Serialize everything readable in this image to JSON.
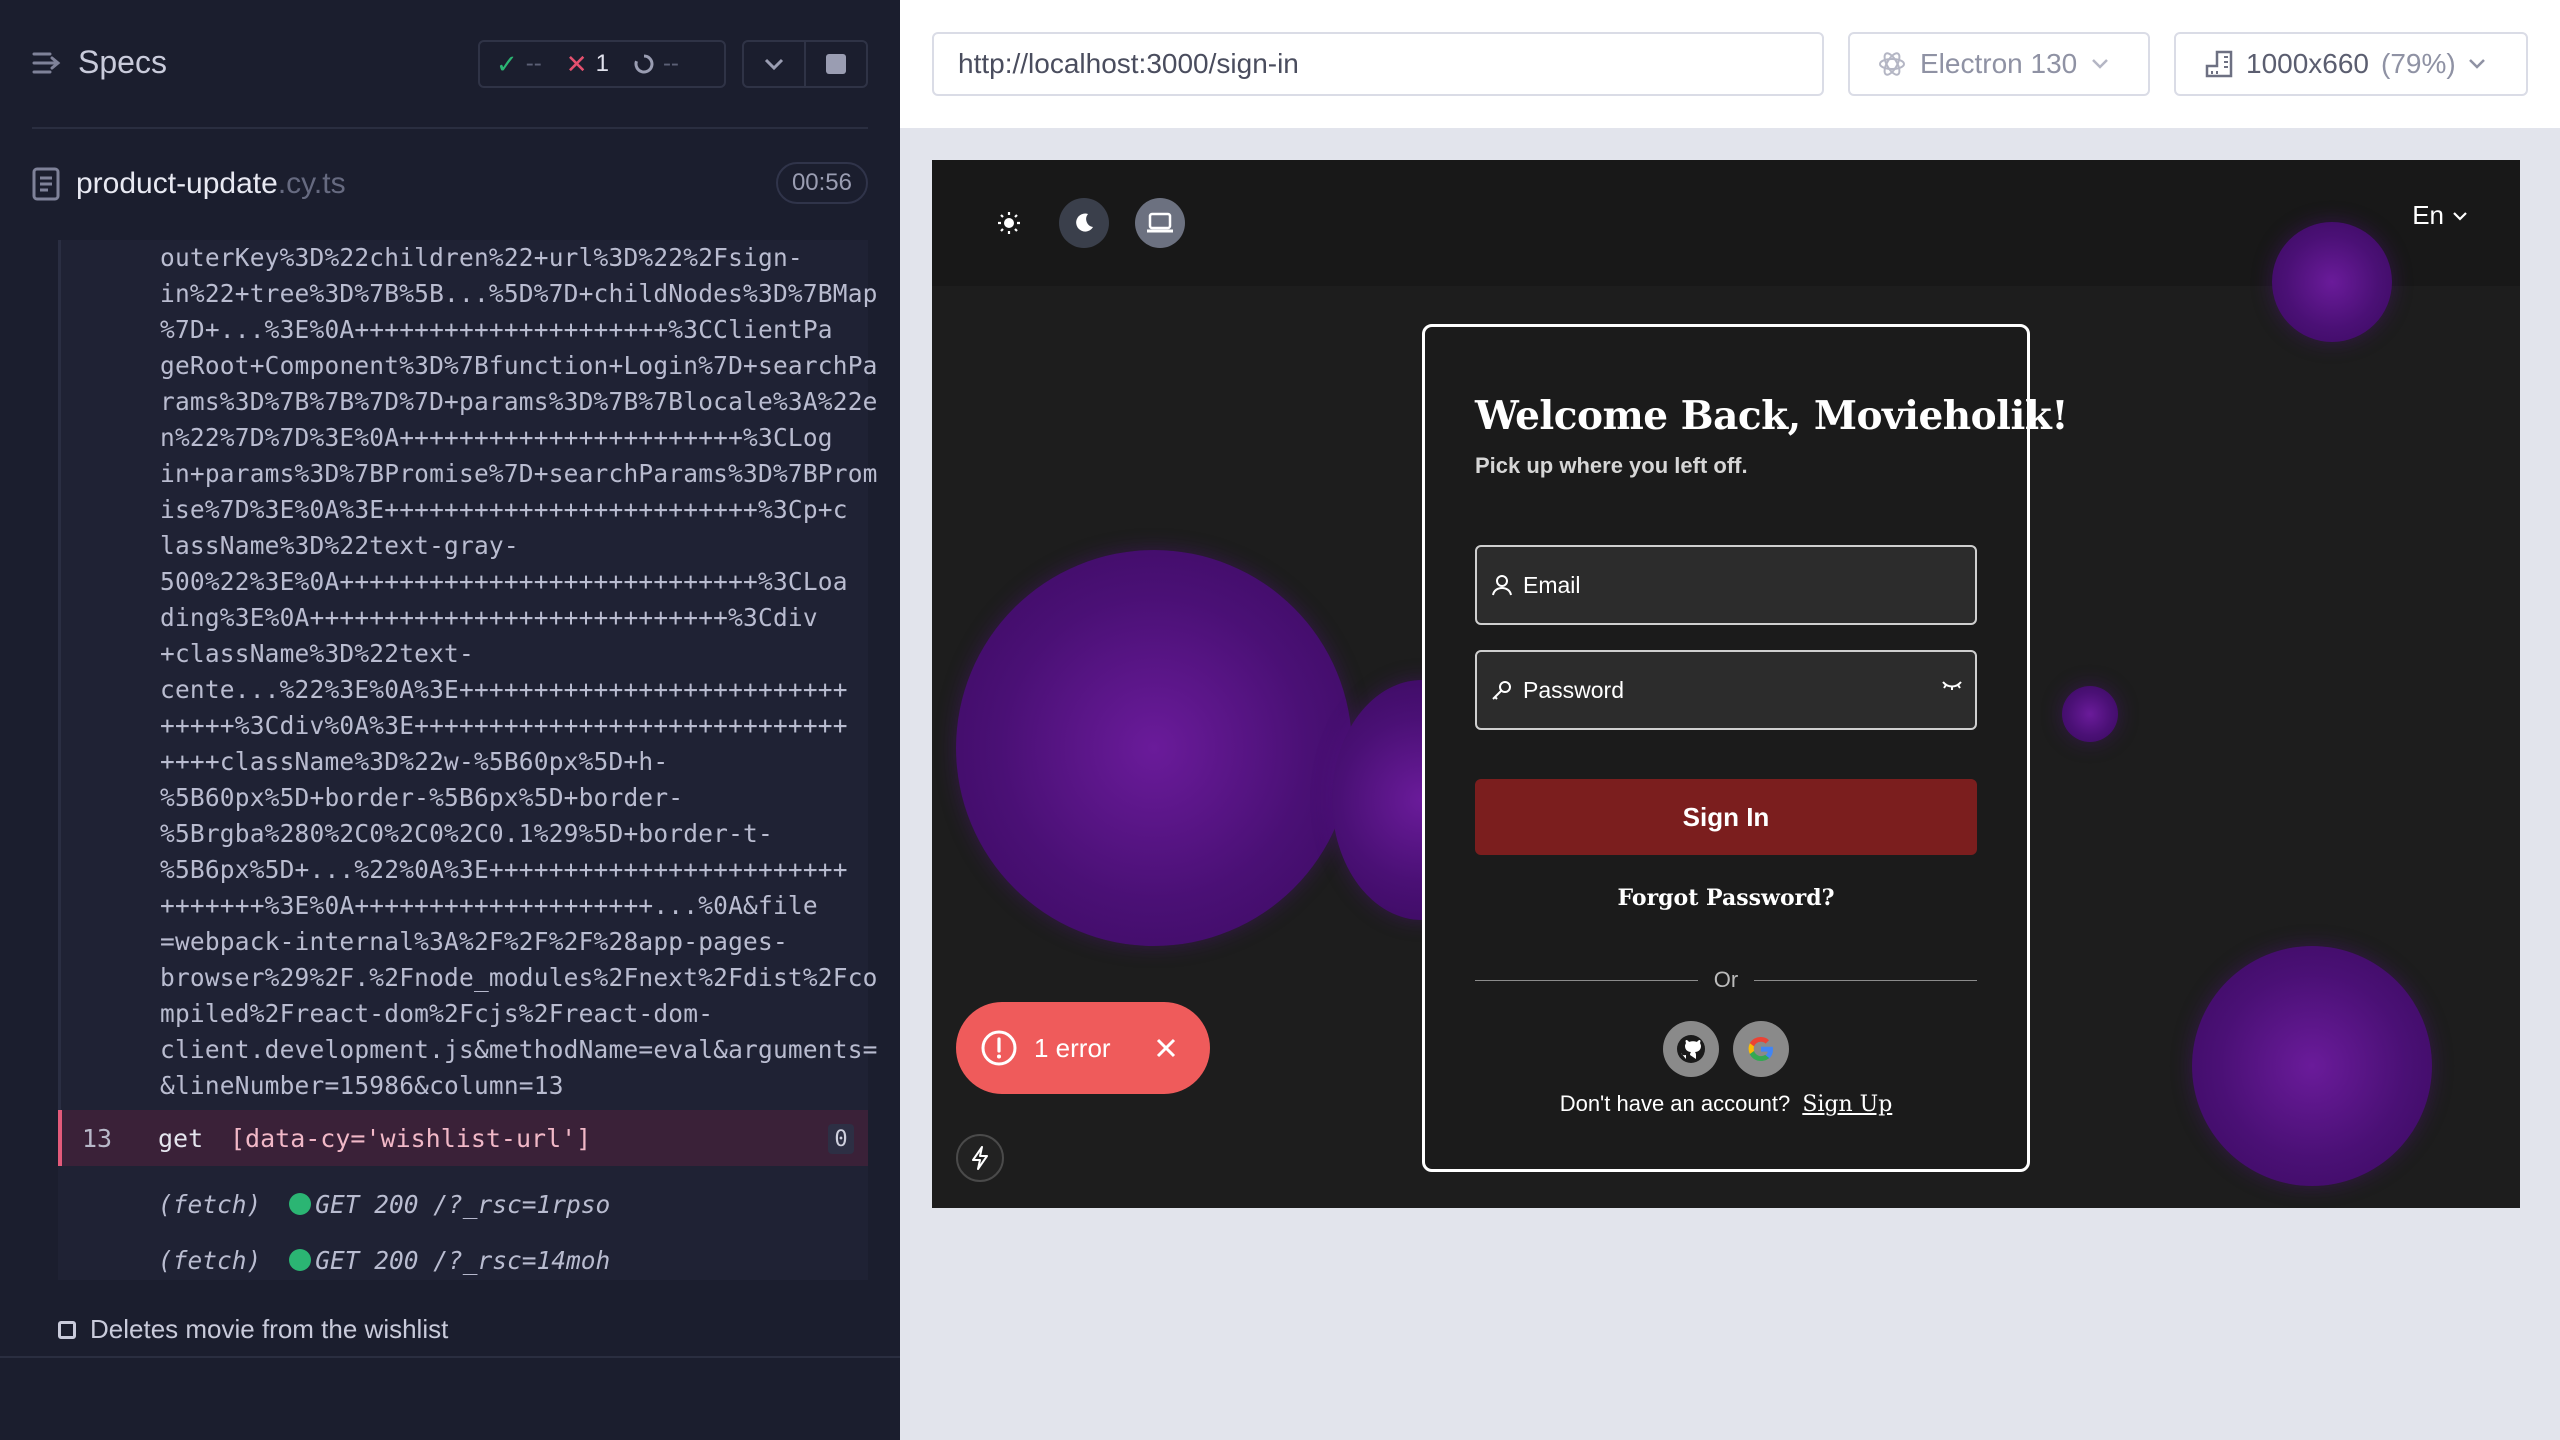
{
  "reporter": {
    "specs_label": "Specs",
    "stats": {
      "passed": "--",
      "failed": "1",
      "pending": "--"
    },
    "spec": {
      "file_name": "product-update",
      "file_ext": ".cy.ts",
      "duration": "00:56"
    },
    "long_message_lines": [
      "outerKey%3D%22children%22+url%3D%22%2Fsign-",
      "in%22+tree%3D%7B%5B...%5D%7D+childNodes%3D%7BMap",
      "%7D+...%3E%0A+++++++++++++++++++++%3CClientPa",
      "geRoot+Component%3D%7Bfunction+Login%7D+searchPa",
      "rams%3D%7B%7B%7D%7D+params%3D%7B%7Blocale%3A%22e",
      "n%22%7D%7D%3E%0A+++++++++++++++++++++++%3CLog",
      "in+params%3D%7BPromise%7D+searchParams%3D%7BProm",
      "ise%7D%3E%0A%3E+++++++++++++++++++++++++%3Cp+c",
      "lassName%3D%22text-gray-",
      "500%22%3E%0A++++++++++++++++++++++++++++%3CLoa",
      "ding%3E%0A++++++++++++++++++++++++++++%3Cdiv",
      "+className%3D%22text-",
      "cente...%22%3E%0A%3E++++++++++++++++++++++++++",
      "+++++%3Cdiv%0A%3E+++++++++++++++++++++++++++++",
      "++++className%3D%22w-%5B60px%5D+h-",
      "%5B60px%5D+border-%5B6px%5D+border-",
      "%5Brgba%280%2C0%2C0%2C0.1%29%5D+border-t-",
      "%5B6px%5D+...%22%0A%3E++++++++++++++++++++++++",
      "+++++++%3E%0A++++++++++++++++++++...%0A&file",
      "=webpack-internal%3A%2F%2F%2F%28app-pages-",
      "browser%29%2F.%2Fnode_modules%2Fnext%2Fdist%2Fco",
      "mpiled%2Freact-dom%2Fcjs%2Freact-dom-",
      "client.development.js&methodName=eval&arguments=",
      "&lineNumber=15986&column=13"
    ],
    "active_command": {
      "number": "13",
      "name": "get",
      "message": "[data-cy='wishlist-url']",
      "count": "0"
    },
    "fetch_rows": [
      {
        "label": "(fetch)",
        "message": "GET 200 /?_rsc=1rpso"
      },
      {
        "label": "(fetch)",
        "message": "GET 200 /?_rsc=14moh"
      }
    ],
    "test_title": "Deletes movie from the wishlist"
  },
  "aut": {
    "url": "http://localhost:3000/sign-in",
    "browser": "Electron 130",
    "viewport": "1000x660",
    "zoom": "(79%)"
  },
  "app": {
    "language": "En",
    "heading": "Welcome Back, Movieholik!",
    "subheading": "Pick up where you left off.",
    "email_placeholder": "Email",
    "password_placeholder": "Password",
    "sign_in": "Sign In",
    "forgot": "Forgot Password?",
    "or": "Or",
    "no_account": "Don't have an account?",
    "sign_up": "Sign Up",
    "error_badge": "1 error"
  },
  "colors": {
    "reporter_bg": "#1b1e2e",
    "failed": "#e4506e",
    "passed": "#2bb573",
    "signin_btn": "#7b1e1e",
    "error_pill": "#ef5b5b",
    "orb": "#5a1488"
  }
}
